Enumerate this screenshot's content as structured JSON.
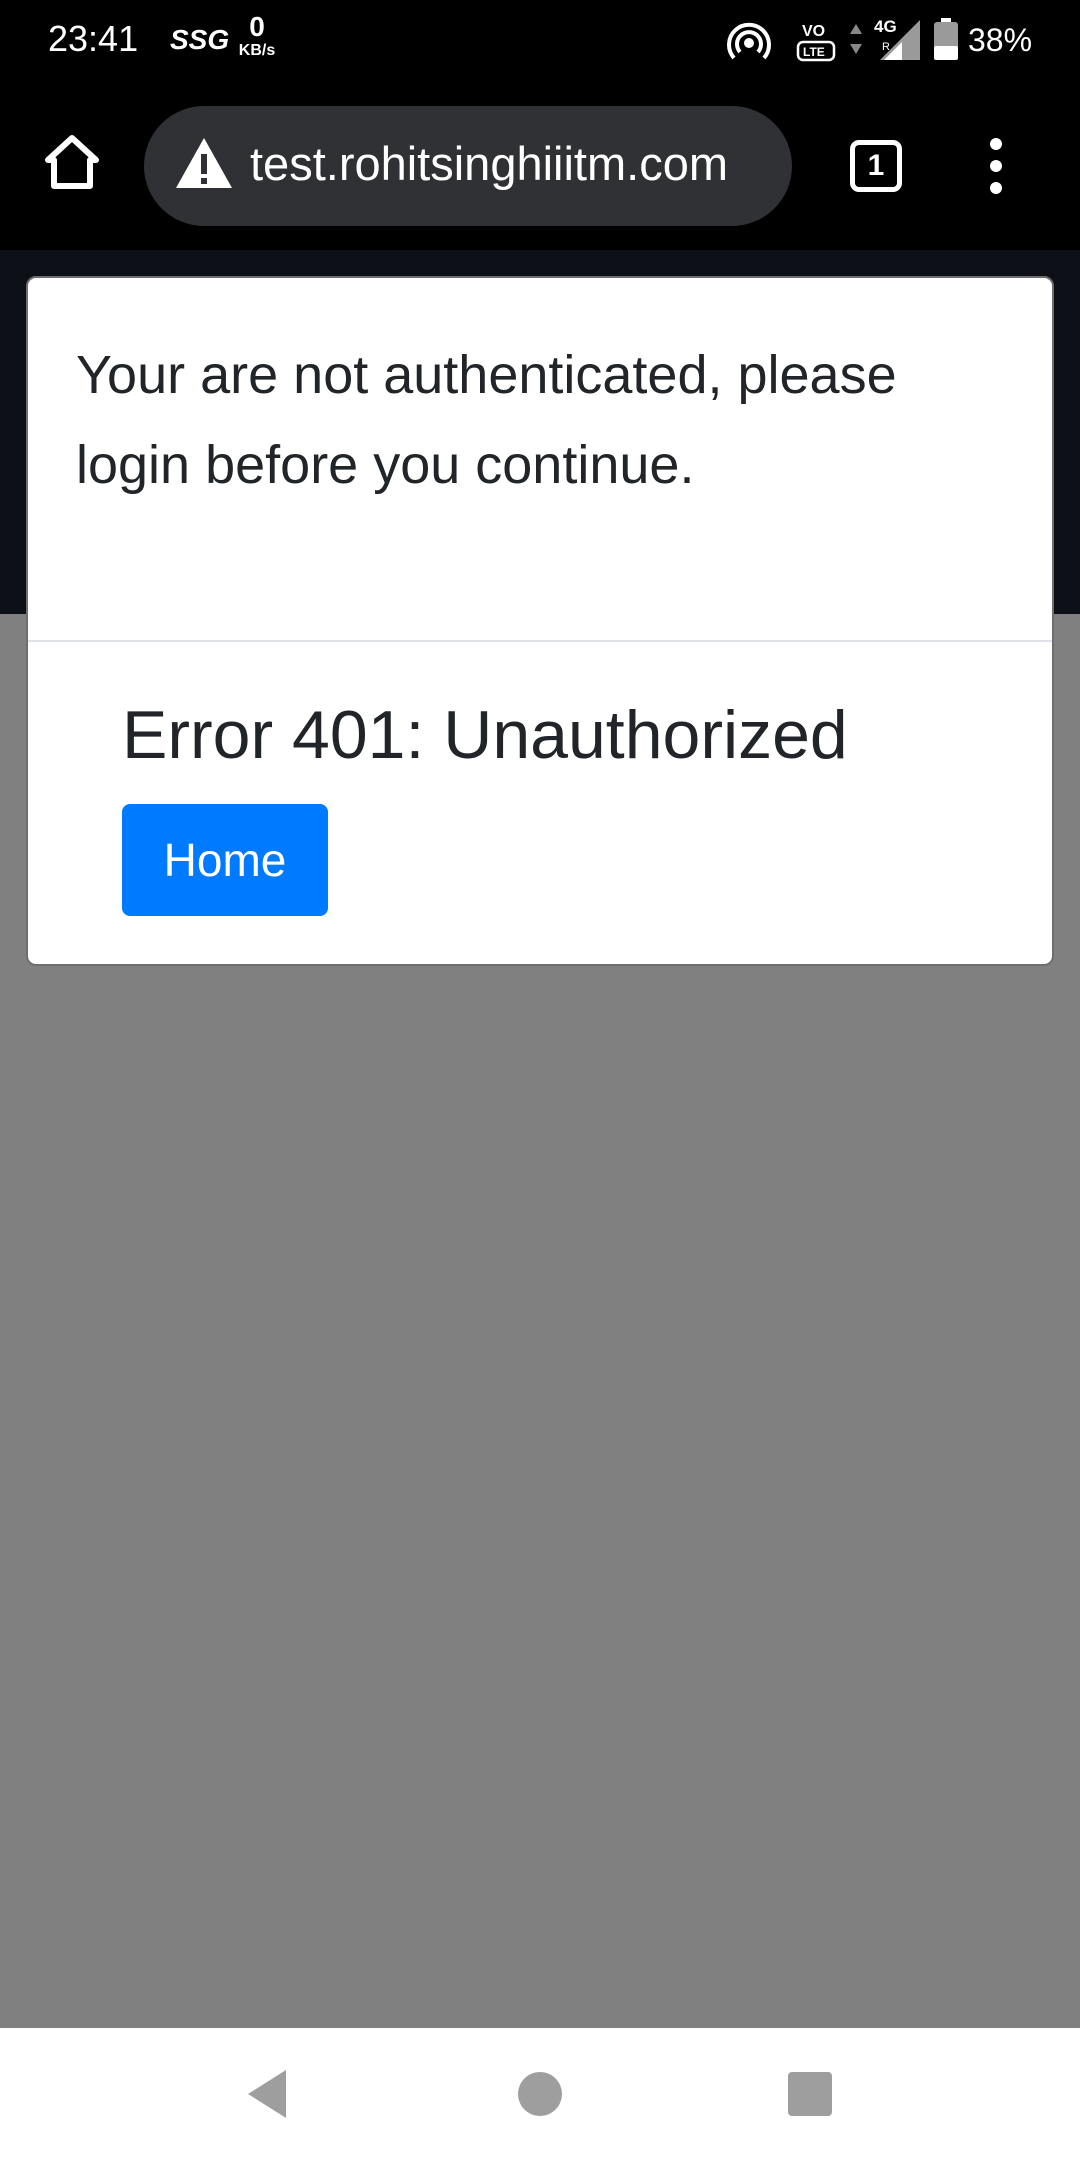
{
  "status_bar": {
    "time": "23:41",
    "carrier_badge": "SSG",
    "net_speed_value": "0",
    "net_speed_unit": "KB/s",
    "volte_label": "VO LTE",
    "network_type": "4G",
    "battery_percent": "38%"
  },
  "browser": {
    "url": "test.rohitsinghiiitm.com",
    "tab_count": "1",
    "icons": {
      "home": "home-icon",
      "warning": "warning-icon",
      "tabs": "tabs-icon",
      "menu": "more-vertical-icon"
    }
  },
  "modal": {
    "message": "Your are not authenticated, please login before you continue.",
    "error_title": "Error 401: Unauthorized",
    "home_button_label": "Home"
  },
  "nav_bar": {
    "icons": [
      "back-icon",
      "home-circle-icon",
      "recents-icon"
    ]
  },
  "colors": {
    "primary_button": "#007bff",
    "page_overlay": "#808080",
    "url_bar": "#303134"
  }
}
